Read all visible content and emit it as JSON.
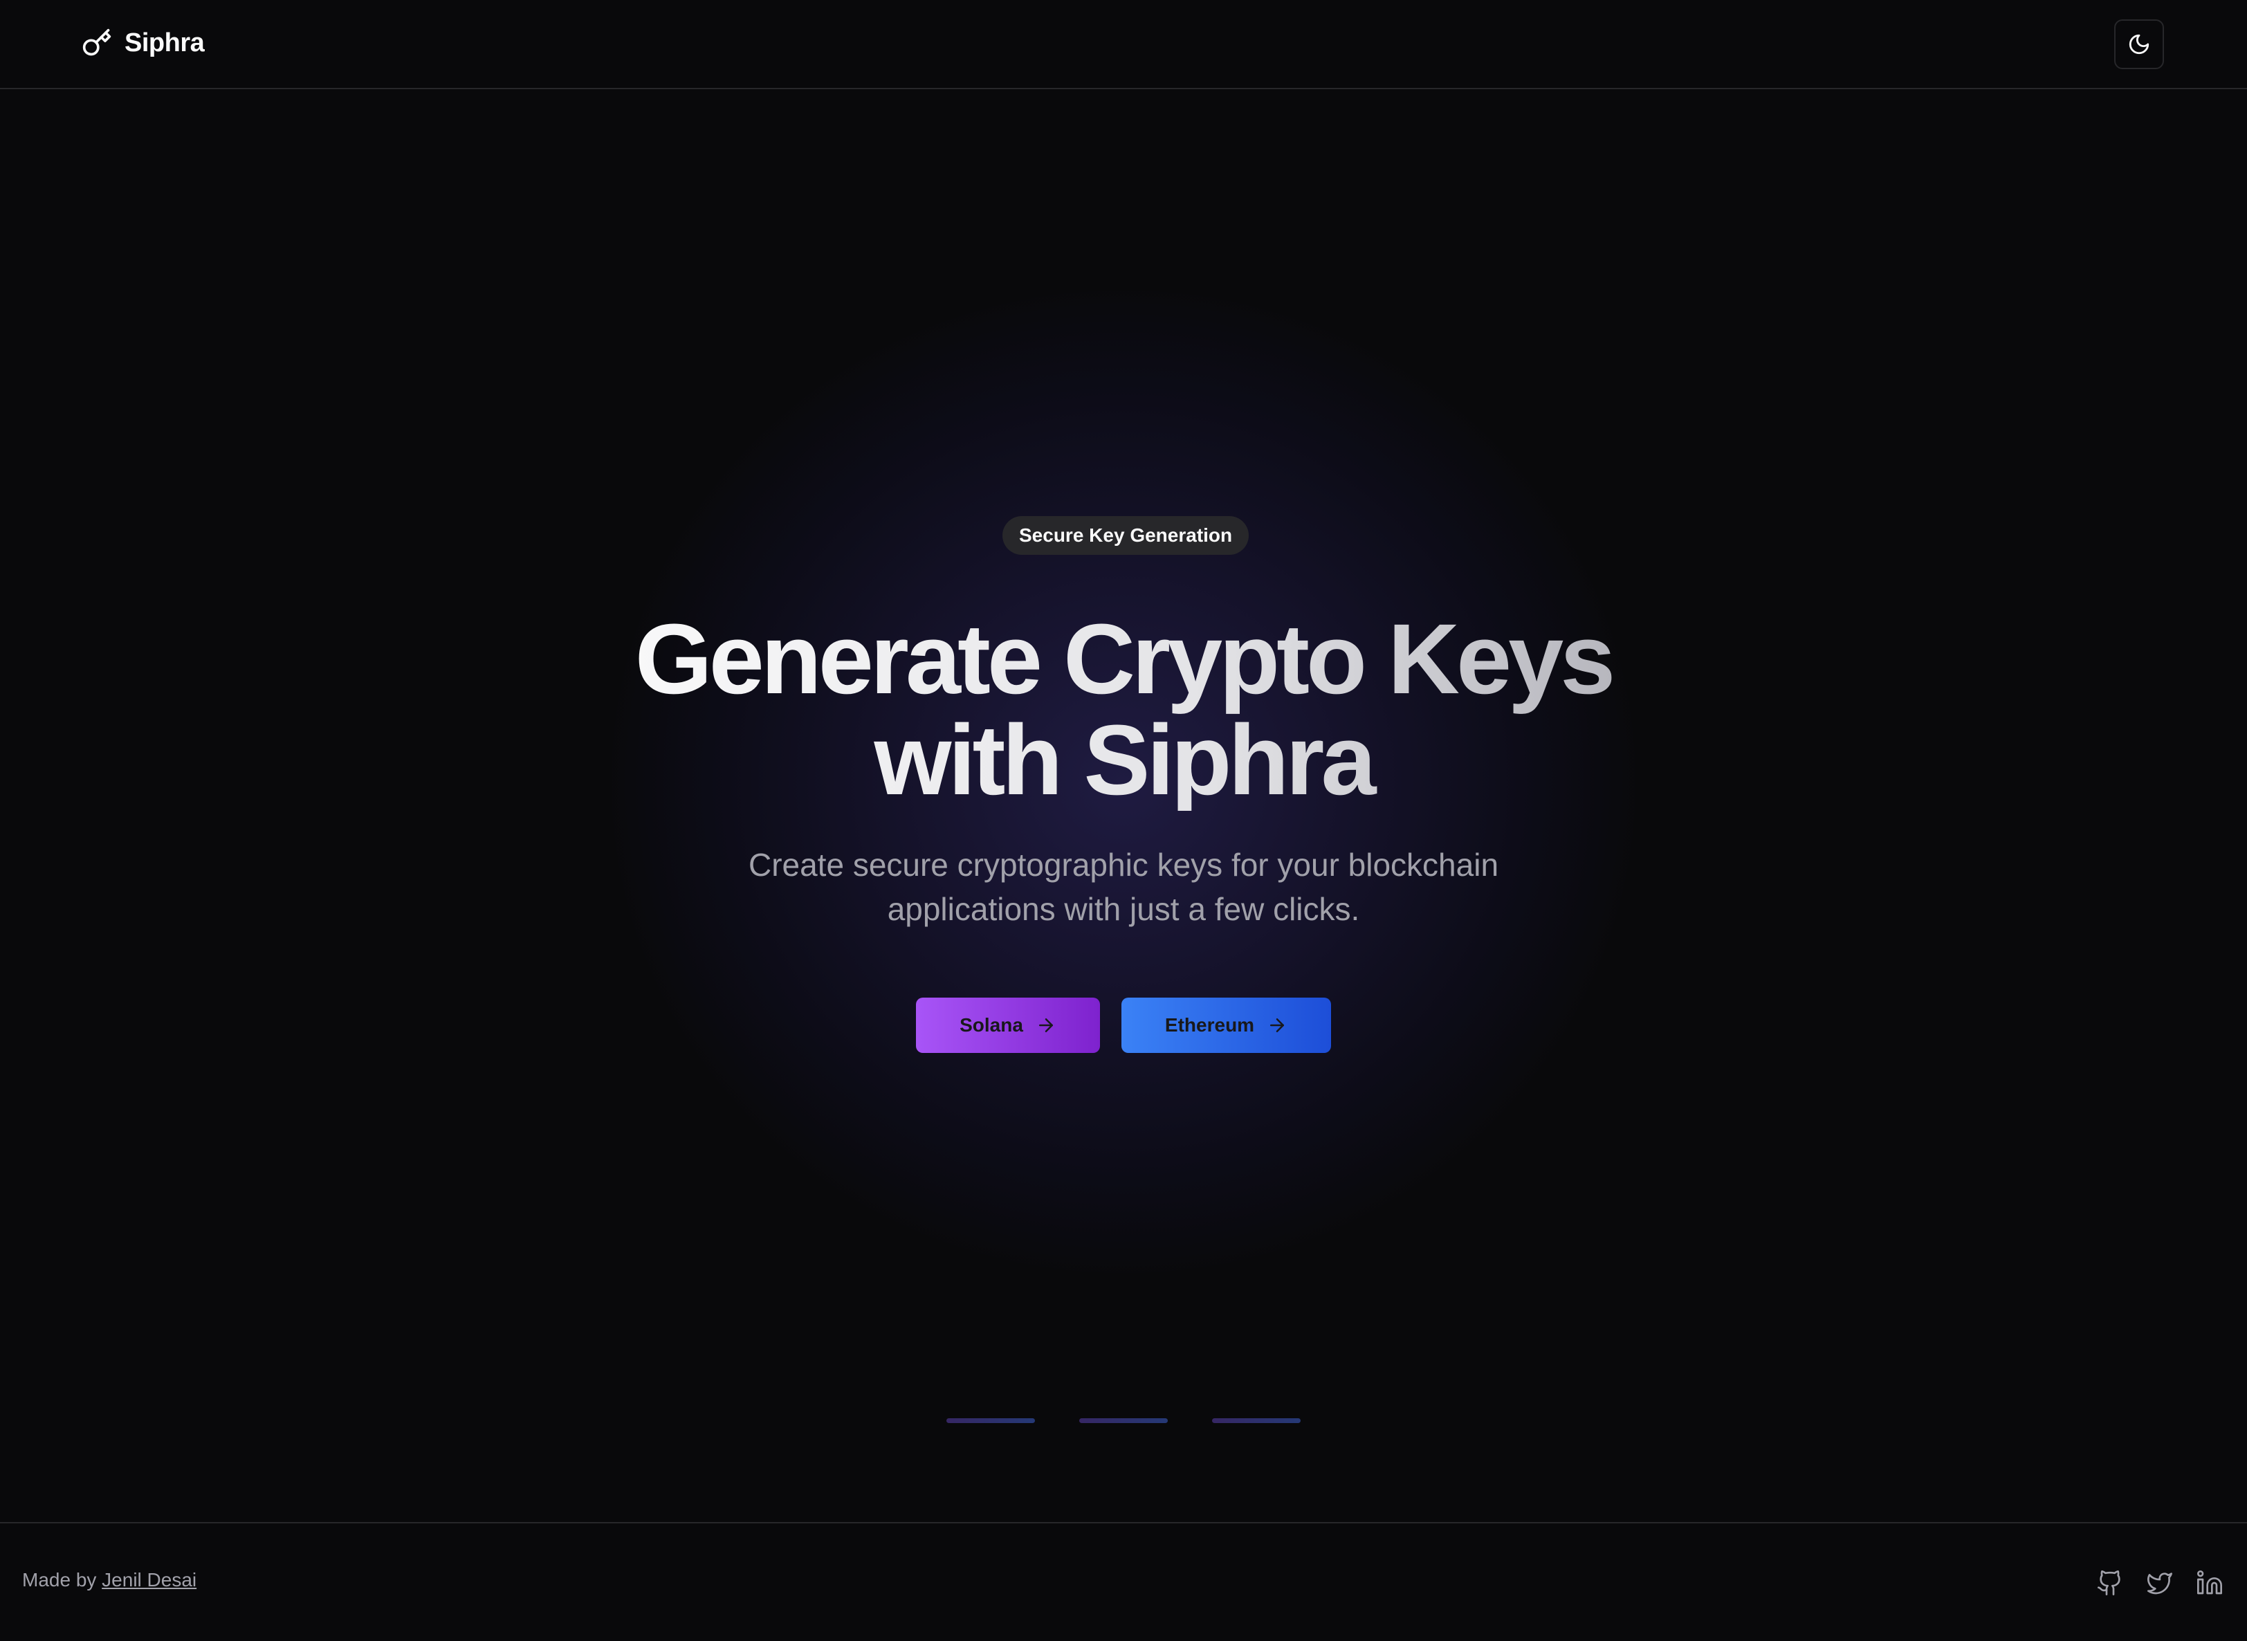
{
  "header": {
    "brand_name": "Siphra",
    "brand_icon": "key-icon",
    "theme_toggle_icon": "moon-icon"
  },
  "hero": {
    "badge": "Secure Key Generation",
    "title_line1": "Generate Crypto Keys",
    "title_line2": "with Siphra",
    "subtitle_line1": "Create secure cryptographic keys for your blockchain",
    "subtitle_line2": "applications with just a few clicks.",
    "buttons": [
      {
        "label": "Solana",
        "icon": "arrow-right-icon",
        "color_from": "#a855f7",
        "color_to": "#7e22ce"
      },
      {
        "label": "Ethereum",
        "icon": "arrow-right-icon",
        "color_from": "#3b82f6",
        "color_to": "#1d4ed8"
      }
    ]
  },
  "carousel": {
    "indicator_count": 3
  },
  "footer": {
    "made_by_prefix": "Made by ",
    "author": "Jenil Desai",
    "social": [
      "github-icon",
      "twitter-icon",
      "linkedin-icon"
    ]
  },
  "colors": {
    "background": "#09090b",
    "border": "#27272a",
    "muted_text": "#a1a1aa",
    "glow": "#312a6e"
  }
}
